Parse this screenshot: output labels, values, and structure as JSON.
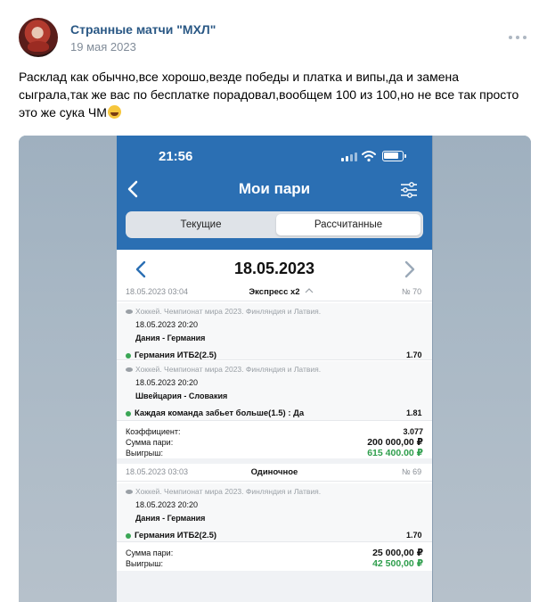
{
  "post": {
    "author": "Странные матчи \"МХЛ\"",
    "date": "19 мая 2023",
    "text": "Расклад как обычно,все хорошо,везде победы и платка и випы,да и замена сыграла,так же вас по бесплатке порадовал,вообщем 100 из 100,но не все так просто это же сука ЧМ",
    "emoji": "laughing-face-emoji"
  },
  "screenshot": {
    "status_time": "21:56",
    "title": "Мои пари",
    "tabs": {
      "current": "Текущие",
      "settled": "Рассчитанные"
    },
    "selected_tab": "settled",
    "date": "18.05.2023",
    "bets": [
      {
        "datetime": "18.05.2023 03:04",
        "type": "Экспресс x2",
        "number": "№ 70",
        "events": [
          {
            "league": "Хоккей. Чемпионат мира 2023. Финляндия и Латвия.",
            "time": "18.05.2023 20:20",
            "teams": "Дания - Германия",
            "pick": "Германия ИТБ2(2.5)",
            "odds": "1.70"
          },
          {
            "league": "Хоккей. Чемпионат мира 2023. Финляндия и Латвия.",
            "time": "18.05.2023 20:20",
            "teams": "Швейцария - Словакия",
            "pick": "Каждая команда забьет больше(1.5) : Да",
            "odds": "1.81"
          }
        ],
        "summary": {
          "coef_label": "Коэффициент:",
          "coef": "3.077",
          "stake_label": "Сумма пари:",
          "stake": "200 000,00 ₽",
          "win_label": "Выигрыш:",
          "win": "615 400.00 ₽"
        }
      },
      {
        "datetime": "18.05.2023 03:03",
        "type": "Одиночное",
        "number": "№ 69",
        "events": [
          {
            "league": "Хоккей. Чемпионат мира 2023. Финляндия и Латвия.",
            "time": "18.05.2023 20:20",
            "teams": "Дания - Германия",
            "pick": "Германия ИТБ2(2.5)",
            "odds": "1.70"
          }
        ],
        "summary": {
          "stake_label": "Сумма пари:",
          "stake": "25 000,00 ₽",
          "win_label": "Выигрыш:",
          "win": "42 500,00 ₽"
        }
      }
    ]
  },
  "colors": {
    "link": "#2a5885",
    "header_blue": "#2b6fb3",
    "win_green": "#2e9e4c"
  }
}
